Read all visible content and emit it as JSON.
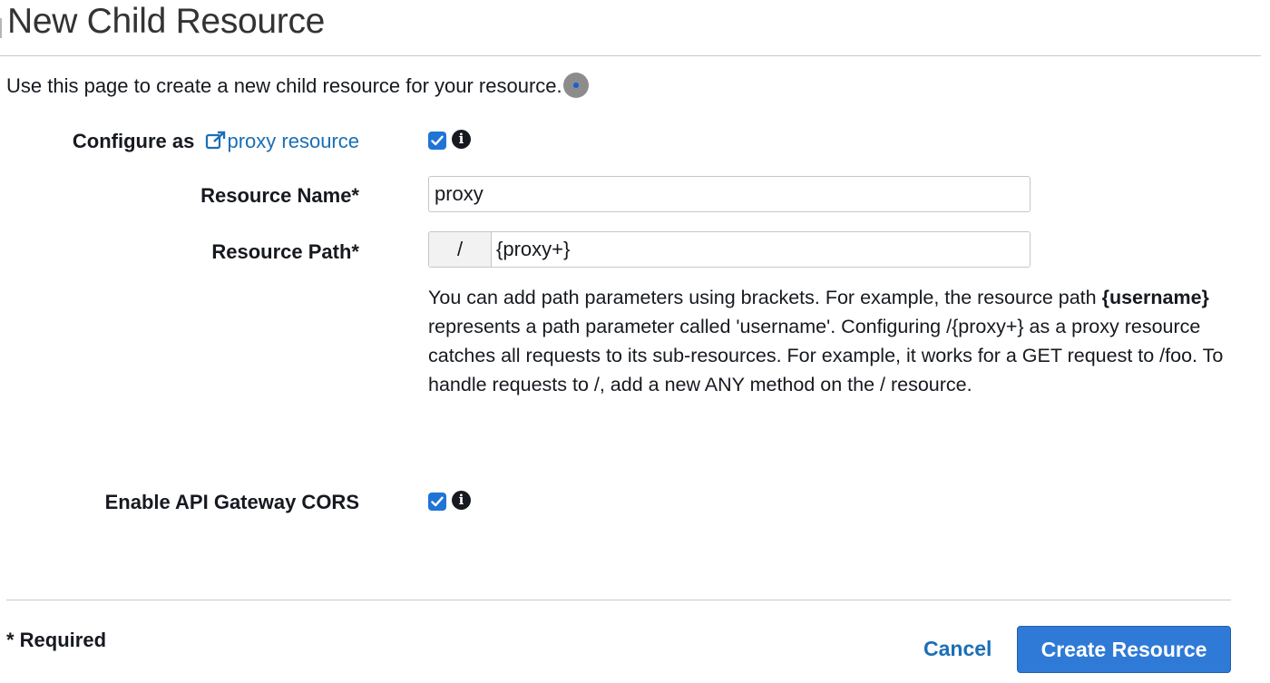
{
  "page": {
    "title": "New Child Resource",
    "description": "Use this page to create a new child resource for your resource."
  },
  "form": {
    "proxy": {
      "label_prefix": "Configure as",
      "link_text": "proxy resource",
      "link_icon": "external-link-icon",
      "checked": true,
      "info_icon": "info-icon",
      "info_glyph": "i"
    },
    "resource_name": {
      "label": "Resource Name*",
      "value": "proxy"
    },
    "resource_path": {
      "label": "Resource Path*",
      "prefix": "/",
      "value": "{proxy+}",
      "help_bold": "{username}",
      "help_part1": "You can add path parameters using brackets. For example, the resource path",
      "help_part2": "represents a path parameter called 'username'. Configuring /{proxy+} as a proxy resource catches all requests to its sub-resources. For example, it works for a GET request to /foo. To handle requests to /, add a new ANY method on the / resource."
    },
    "cors": {
      "label": "Enable API Gateway CORS",
      "checked": true,
      "info_glyph": "i"
    }
  },
  "footer": {
    "required_note": "* Required",
    "cancel_label": "Cancel",
    "create_label": "Create Resource"
  },
  "colors": {
    "link": "#1a6fb5",
    "checkbox": "#1f74d6",
    "primary_button": "#2f7ad6"
  }
}
